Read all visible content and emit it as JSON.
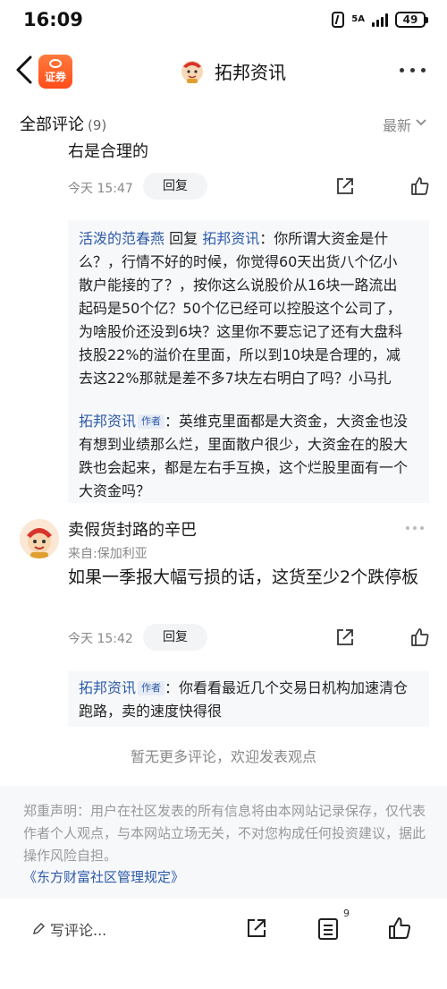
{
  "status_bar": {
    "time": "16:09",
    "network": "5A",
    "battery": "49"
  },
  "header": {
    "title": "拓邦资讯",
    "app_logo_text": "证券"
  },
  "comments_header": {
    "title": "全部评论",
    "count": "(9)",
    "sort": "最新"
  },
  "comment1": {
    "text_tail": "右是合理的",
    "time": "今天 15:47",
    "reply_label": "回复",
    "replies": [
      {
        "user": "活泼的范春燕",
        "reply_word": " 回复 ",
        "target": "拓邦资讯",
        "text": "：你所谓大资金是什么？，行情不好的时候，你觉得60天出货八个亿小散户能接的了？，按你这么说股价从16块一路流出起码是50个亿？50个亿已经可以控股这个公司了，为啥股价还没到6块？这里你不要忘记了还有大盘科技股22%的溢价在里面，所以到10块是合理的，减去这22%那就是差不多7块左右明白了吗？小马扎"
      },
      {
        "user": "拓邦资讯",
        "author_tag": "作者",
        "text": "：英维克里面都是大资金，大资金也没有想到业绩那么烂，里面散户很少，大资金在的股大跌也会起来，都是左右手互换，这个烂股里面有一个大资金吗？"
      }
    ]
  },
  "comment2": {
    "username": "卖假货封路的辛巴",
    "source": "来自:保加利亚",
    "text": "如果一季报大幅亏损的话，这货至少2个跌停板",
    "time": "今天 15:42",
    "reply_label": "回复",
    "reply": {
      "user": "拓邦资讯",
      "author_tag": "作者",
      "text": "：你看看最近几个交易日机构加速清仓跑路，卖的速度快得很"
    }
  },
  "end_note": "暂无更多评论，欢迎发表观点",
  "disclaimer": {
    "text": "郑重声明：用户在社区发表的所有信息将由本网站记录保存，仅代表作者个人观点，与本网站立场无关，不对您构成任何投资建议，据此操作风险自担。",
    "link": "《东方财富社区管理规定》"
  },
  "bottom_bar": {
    "write_placeholder": "写评论...",
    "comment_badge": "9"
  }
}
